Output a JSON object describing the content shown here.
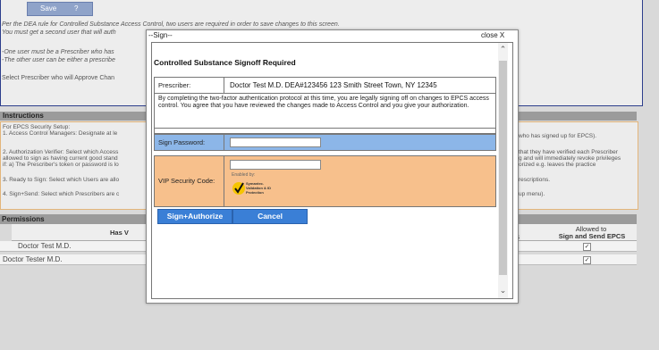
{
  "toolbar": {
    "save_label": "Save"
  },
  "top": {
    "dea_line1": "Per the DEA rule for Controlled Substance Access Control, two users are required in order to save changes to this screen.",
    "dea_line2": "You must get a second user that will auth",
    "one_line1": "-One user must be a Prescriber who has",
    "one_line2": "-The other user can be either a prescribe",
    "select_prescriber": "Select Prescriber who will Approve Chan"
  },
  "instructions": {
    "title": "Instructions",
    "lines_left": [
      "For EPCS Security Setup:",
      "1. Access Control Managers: Designate at le",
      "2. Authorization Verifier: Select which Access",
      "allowed to sign as having current good stand",
      "if: a) The Prescriber's token or password is lo",
      "3. Ready to Sign: Select which Users are allo",
      "4. Sign+Send: Select which Prescribers are c"
    ],
    "lines_right": [
      "who has signed up for EPCS).",
      "that they have verified each Prescriber",
      "g and will immediately revoke privileges",
      "orized e.g. leaves the practice",
      "rescriptions.",
      "up menu)."
    ]
  },
  "permissions": {
    "title": "Permissions",
    "header_left": "Has V",
    "header_mid": "S",
    "header_right_1": "Allowed to",
    "header_right_2": "Sign and Send EPCS",
    "rows": [
      {
        "name": "Doctor Test M.D.",
        "checked": true
      },
      {
        "name": "Doctor Tester M.D.",
        "checked": true
      }
    ]
  },
  "modal": {
    "title": "--Sign--",
    "close_label": "close X",
    "heading": "Controlled Substance Signoff Required",
    "prescriber_label": "Prescriber:",
    "prescriber_value": "Doctor Test M.D. DEA#123456 123 Smith Street Town, NY 12345",
    "agreement_text": "By completing the two-factor authentication protocol at this time, you are legally signing off on changes to EPCS access control. You agree that you have reviewed the changes made to Access Control and you give your authorization.",
    "password_label": "Sign Password:",
    "password_value": "",
    "vip_label": "VIP Security Code:",
    "vip_value": "",
    "enabled_by": "Enabled by:",
    "symantec_text": "Symantec. Validation & ID Protection",
    "sign_authorize_label": "Sign+Authorize",
    "cancel_label": "Cancel"
  },
  "colors": {
    "accent_blue": "#3a7fd6",
    "password_row": "#8cb6e8",
    "vip_row": "#f7c08c"
  }
}
